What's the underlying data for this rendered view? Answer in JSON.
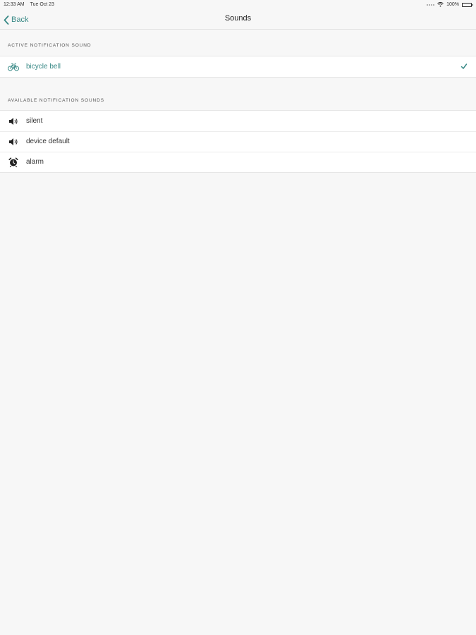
{
  "status_bar": {
    "time": "12:33 AM",
    "date": "Tue Oct 23",
    "battery": "100%",
    "icons": [
      "signal-icon",
      "wifi-icon",
      "battery-icon"
    ]
  },
  "nav": {
    "back_label": "Back",
    "title": "Sounds"
  },
  "active_section": {
    "header": "Active Notification Sound",
    "items": [
      {
        "label": "bicycle bell",
        "icon": "bicycle-icon",
        "selected": true
      }
    ]
  },
  "available_section": {
    "header": "Available Notification Sounds",
    "items": [
      {
        "label": "silent",
        "icon": "speaker-icon"
      },
      {
        "label": "device default",
        "icon": "speaker-icon"
      },
      {
        "label": "alarm",
        "icon": "alarm-clock-icon"
      }
    ]
  },
  "colors": {
    "accent": "#3a8a87",
    "background": "#f7f7f7",
    "row_background": "#ffffff"
  }
}
